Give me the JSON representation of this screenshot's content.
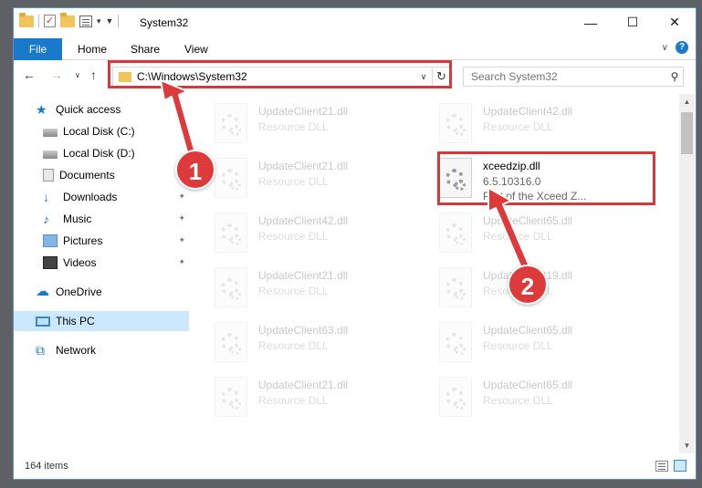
{
  "window": {
    "title": "System32",
    "controls": {
      "minimize": "—",
      "maximize": "☐",
      "close": "✕"
    }
  },
  "ribbon": {
    "tabs": [
      "File",
      "Home",
      "Share",
      "View"
    ],
    "expand": "∨",
    "help": "?"
  },
  "nav": {
    "back": "←",
    "forward": "→",
    "recent": "∨",
    "up": "↑",
    "address": "C:\\Windows\\System32",
    "address_dropdown": "∨",
    "refresh": "↻",
    "search_placeholder": "Search System32",
    "search_icon": "⚲"
  },
  "sidebar": {
    "items": [
      {
        "label": "Quick access",
        "icon": "star-icon",
        "pinned": false,
        "selected": false
      },
      {
        "label": "Local Disk (C:)",
        "icon": "disk-icon",
        "pinned": false,
        "selected": false
      },
      {
        "label": "Local Disk (D:)",
        "icon": "disk-icon",
        "pinned": false,
        "selected": false
      },
      {
        "label": "Documents",
        "icon": "documents-icon",
        "pinned": false,
        "selected": false
      },
      {
        "label": "Downloads",
        "icon": "downloads-icon",
        "pinned": true,
        "selected": false
      },
      {
        "label": "Music",
        "icon": "music-icon",
        "pinned": true,
        "selected": false
      },
      {
        "label": "Pictures",
        "icon": "pictures-icon",
        "pinned": true,
        "selected": false
      },
      {
        "label": "Videos",
        "icon": "videos-icon",
        "pinned": true,
        "selected": false
      },
      {
        "label": "OneDrive",
        "icon": "onedrive-icon",
        "pinned": false,
        "selected": false
      },
      {
        "label": "This PC",
        "icon": "this-pc-icon",
        "pinned": false,
        "selected": true
      },
      {
        "label": "Network",
        "icon": "network-icon",
        "pinned": false,
        "selected": false
      }
    ],
    "pin_glyph": "📌"
  },
  "files": [
    {
      "name": "UpdateClient21.dll",
      "line2": "Resource DLL",
      "line3": "",
      "faded": true
    },
    {
      "name": "UpdateClient42.dll",
      "line2": "Resource DLL",
      "line3": "",
      "faded": true
    },
    {
      "name": "UpdateClient21.dll",
      "line2": "Resource DLL",
      "line3": "",
      "faded": true
    },
    {
      "name": "xceedzip.dll",
      "line2": "6.5.10316.0",
      "line3": "Part of the Xceed Z...",
      "faded": false
    },
    {
      "name": "UpdateClient42.dll",
      "line2": "Resource DLL",
      "line3": "",
      "faded": true
    },
    {
      "name": "UpdateClient65.dll",
      "line2": "Resource DLL",
      "line3": "",
      "faded": true
    },
    {
      "name": "UpdateClient21.dll",
      "line2": "Resource DLL",
      "line3": "",
      "faded": true
    },
    {
      "name": "UpdateClient19.dll",
      "line2": "Resource DLL",
      "line3": "",
      "faded": true
    },
    {
      "name": "UpdateClient63.dll",
      "line2": "Resource DLL",
      "line3": "",
      "faded": true
    },
    {
      "name": "UpdateClient65.dll",
      "line2": "Resource DLL",
      "line3": "",
      "faded": true
    },
    {
      "name": "UpdateClient21.dll",
      "line2": "Resource DLL",
      "line3": "",
      "faded": true
    },
    {
      "name": "UpdateClient65.dll",
      "line2": "Resource DLL",
      "line3": "",
      "faded": true
    }
  ],
  "status": {
    "item_count": "164 items"
  },
  "annotations": {
    "step1": "1",
    "step2": "2",
    "color": "#d9383a"
  },
  "colors": {
    "accent": "#1979ca",
    "selected_bg": "#cce8ff",
    "highlight": "#d9383a"
  }
}
